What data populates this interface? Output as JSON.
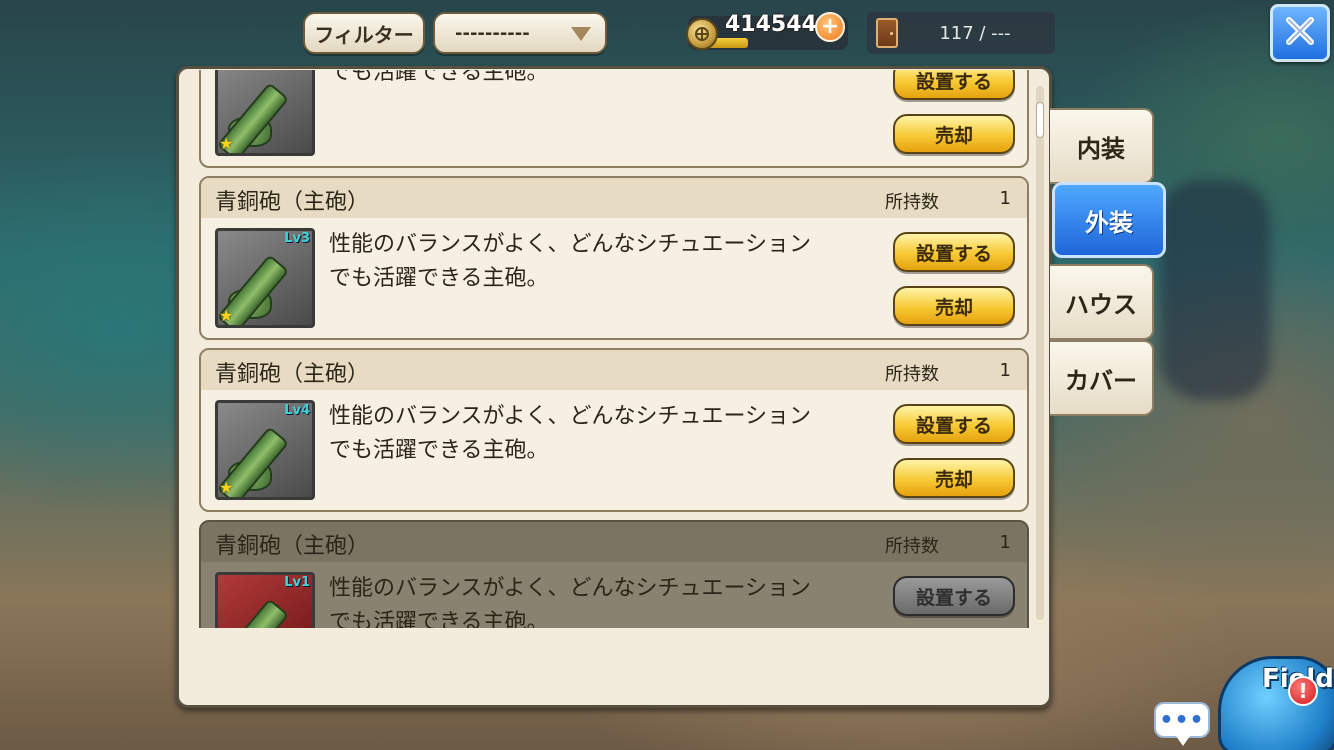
{
  "header": {
    "filter_label": "フィルター",
    "filter_selected": "----------",
    "coins": "414544",
    "capacity": "117 / ---"
  },
  "items": [
    {
      "name": "",
      "owned_label": "",
      "owned_count": "",
      "level": "",
      "stars": 1,
      "description_line1": "",
      "description_line2": "でも活躍できる主砲。",
      "place_label": "設置する",
      "sell_label": "売却"
    },
    {
      "name": "青銅砲（主砲）",
      "owned_label": "所持数",
      "owned_count": "1",
      "level": "Lv3",
      "stars": 1,
      "description_line1": "性能のバランスがよく、どんなシチュエーション",
      "description_line2": "でも活躍できる主砲。",
      "place_label": "設置する",
      "sell_label": "売却"
    },
    {
      "name": "青銅砲（主砲）",
      "owned_label": "所持数",
      "owned_count": "1",
      "level": "Lv4",
      "stars": 1,
      "description_line1": "性能のバランスがよく、どんなシチュエーション",
      "description_line2": "でも活躍できる主砲。",
      "place_label": "設置する",
      "sell_label": "売却"
    },
    {
      "name": "青銅砲（主砲）",
      "owned_label": "所持数",
      "owned_count": "1",
      "level": "Lv1",
      "stars": 1,
      "description_line1": "性能のバランスがよく、どんなシチュエーション",
      "description_line2": "でも活躍できる主砲。",
      "place_label": "設置する",
      "sell_label": "売却",
      "disabled": true
    }
  ],
  "tabs": [
    {
      "label": "内装",
      "active": false
    },
    {
      "label": "外装",
      "active": true
    },
    {
      "label": "ハウス",
      "active": false
    },
    {
      "label": "カバー",
      "active": false
    }
  ],
  "widgets": {
    "chat_label": "•••",
    "field_label": "Field",
    "alert_label": "!"
  },
  "icons": {
    "close": "close-icon",
    "coin": "coin-icon",
    "plus": "plus-icon",
    "door": "door-icon",
    "dropdown": "chevron-down-icon"
  },
  "colors": {
    "accent": "#1e66d8",
    "button_gold": "#f7c934",
    "panel_bg": "#f3ecdc"
  }
}
